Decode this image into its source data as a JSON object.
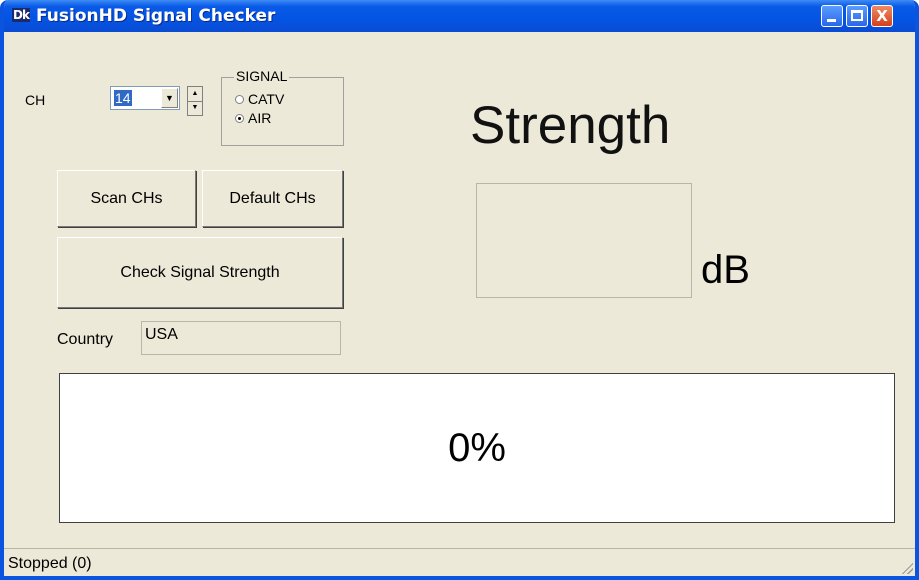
{
  "window": {
    "title": "FusionHD Signal Checker",
    "icon": "fusionhd-app-icon",
    "icon_text": "Dk",
    "controls": {
      "minimize": "minimize-icon",
      "maximize": "maximize-icon",
      "close_glyph": "X"
    }
  },
  "channel": {
    "label": "CH",
    "value": "14",
    "dropdown_arrow": "▼",
    "spin_up": "▲",
    "spin_down": "▼"
  },
  "signal": {
    "group_title": "SIGNAL",
    "options": [
      {
        "label": "CATV",
        "checked": false
      },
      {
        "label": "AIR",
        "checked": true
      }
    ]
  },
  "buttons": {
    "scan": "Scan CHs",
    "default": "Default CHs",
    "check": "Check Signal Strength"
  },
  "country": {
    "label": "Country",
    "value": "USA"
  },
  "strength": {
    "title": "Strength",
    "value": "",
    "unit": "dB"
  },
  "progress": {
    "percent": 0,
    "text": "0%"
  },
  "status": {
    "text": "Stopped (0)"
  },
  "colors": {
    "titlebar": "#0454e3",
    "window_bg": "#ece9d8",
    "close_button": "#d4401c"
  }
}
